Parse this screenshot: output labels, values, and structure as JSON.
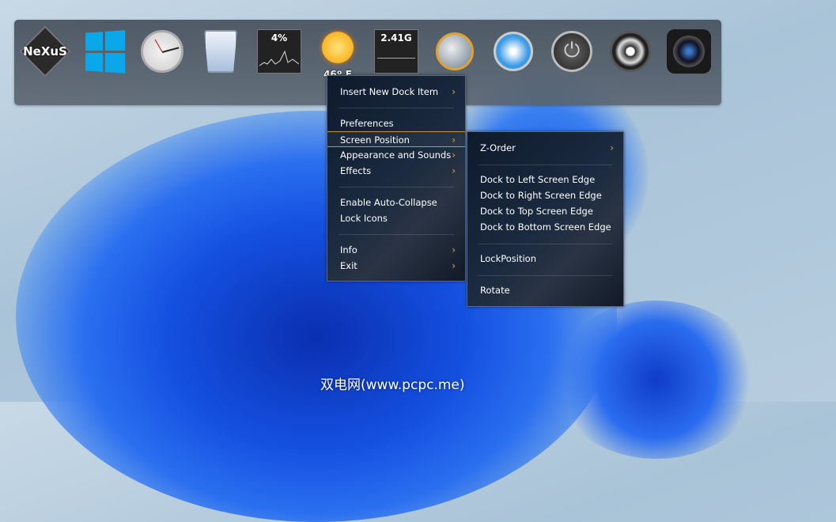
{
  "dock": {
    "items": [
      {
        "name": "nexus-logo-icon",
        "text": "NeXuS"
      },
      {
        "name": "windows-icon",
        "text": ""
      },
      {
        "name": "clock-icon",
        "text": ""
      },
      {
        "name": "recycle-bin-icon",
        "text": ""
      },
      {
        "name": "cpu-meter-icon",
        "text": "4%"
      },
      {
        "name": "weather-icon",
        "text": "46º F"
      },
      {
        "name": "memory-meter-icon",
        "text": "2.41G"
      },
      {
        "name": "globe-icon",
        "text": ""
      },
      {
        "name": "safari-icon",
        "text": ""
      },
      {
        "name": "power-icon",
        "text": ""
      },
      {
        "name": "media-player-icon",
        "text": ""
      },
      {
        "name": "camera-icon",
        "text": ""
      }
    ]
  },
  "menu": {
    "items": [
      "Insert New Dock Item",
      "Preferences",
      "Screen Position",
      "Appearance and Sounds",
      "Effects",
      "Enable Auto-Collapse",
      "Lock Icons",
      "Info",
      "Exit"
    ]
  },
  "submenu": {
    "items": [
      "Z-Order",
      "Dock to Left Screen Edge",
      "Dock to Right Screen Edge",
      "Dock to Top Screen Edge",
      "Dock to Bottom Screen Edge",
      "LockPosition",
      "Rotate"
    ]
  },
  "watermark": "双电网(www.pcpc.me)",
  "arrow": "›"
}
